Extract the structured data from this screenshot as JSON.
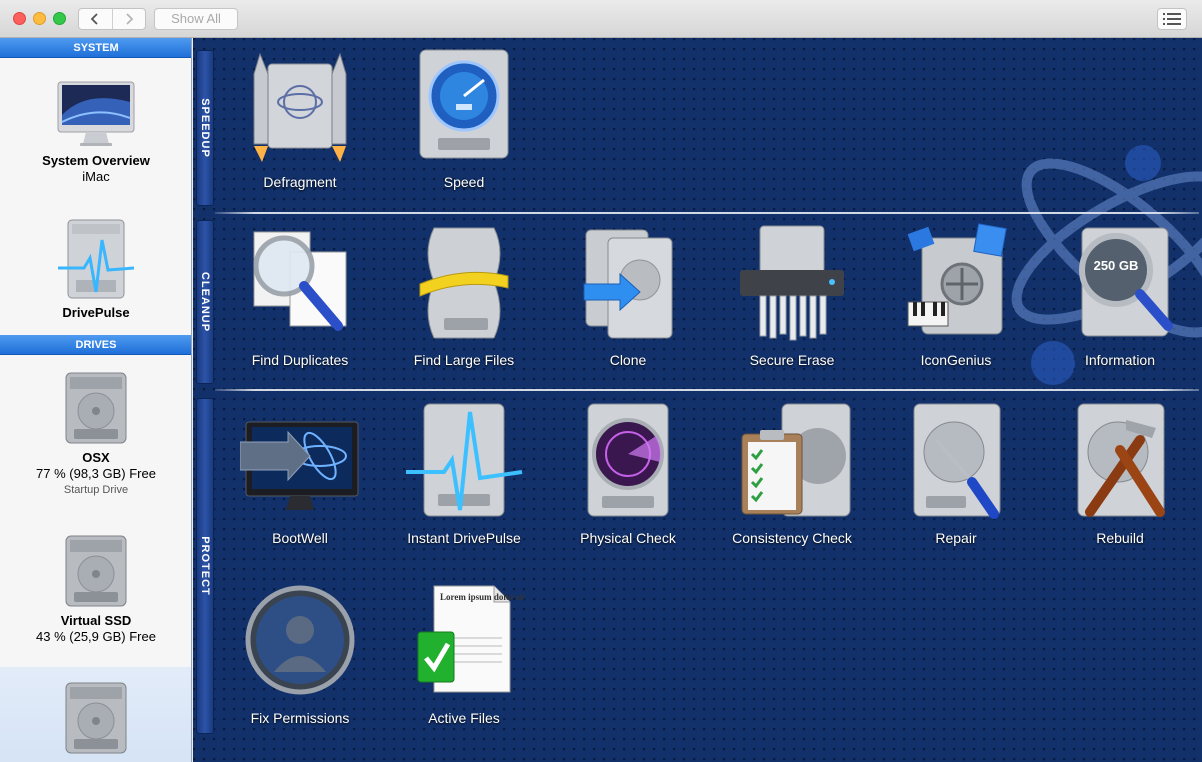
{
  "toolbar": {
    "back_icon": "chevron-left-icon",
    "forward_icon": "chevron-right-icon",
    "show_all_label": "Show All",
    "list_icon": "list-view-icon"
  },
  "sidebar": {
    "system_header": "SYSTEM",
    "system_items": [
      {
        "title": "System Overview",
        "subtitle": "iMac",
        "icon": "imac-icon"
      },
      {
        "title": "DrivePulse",
        "icon": "drivepulse-icon"
      }
    ],
    "drives_header": "DRIVES",
    "drives": [
      {
        "name": "OSX",
        "free": "77 % (98,3 GB) Free",
        "note": "Startup Drive",
        "icon": "hard-drive-icon"
      },
      {
        "name": "Virtual SSD",
        "free": "43 % (25,9 GB) Free",
        "icon": "hard-drive-icon"
      },
      {
        "name": "",
        "icon": "hard-drive-icon",
        "selected": true
      }
    ]
  },
  "sections": {
    "speedup": "SPEEDUP",
    "cleanup": "CLEANUP",
    "protect": "PROTECT"
  },
  "tools": {
    "defragment": "Defragment",
    "speed": "Speed",
    "find_duplicates": "Find Duplicates",
    "find_large_files": "Find Large Files",
    "clone": "Clone",
    "secure_erase": "Secure Erase",
    "icongenius": "IconGenius",
    "information": "Information",
    "bootwell": "BootWell",
    "instant_drivepulse": "Instant DrivePulse",
    "physical_check": "Physical Check",
    "consistency_check": "Consistency Check",
    "repair": "Repair",
    "rebuild": "Rebuild",
    "fix_permissions": "Fix Permissions",
    "active_files": "Active Files"
  },
  "icon_text": {
    "information_capacity": "250 GB",
    "active_files_doc": "Lorem ipsum dolor sit amet"
  },
  "colors": {
    "main_bg": "#12316b",
    "sidebar_header": "#1e6fd9",
    "label": "#ffffff"
  }
}
